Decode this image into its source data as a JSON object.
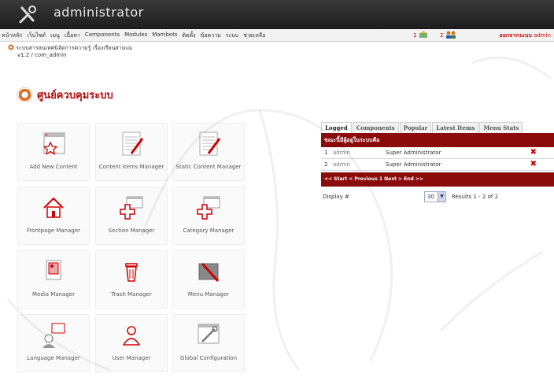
{
  "header": {
    "title": "administrator"
  },
  "menu": {
    "items": [
      "หน้าหลัก",
      "เว็บไซต์",
      "เมนู",
      "เนื้อหา",
      "Components",
      "Modules",
      "Mambots",
      "ติดตั้ง",
      "ข้อความ",
      "ระบบ",
      "ช่วยเหลือ"
    ],
    "messages_count": "1",
    "users_count": "2",
    "logout_prefix": "ออกจากระบบ",
    "logout_user": "admin"
  },
  "sitepath": {
    "site_name": "ระบบสารสนเทศนิจัดการความรู้ เรื่องเรียนสามเณ",
    "version": "v1.2 / com_admin"
  },
  "page": {
    "title": "ศูนย์ควบคุมระบบ"
  },
  "icons": [
    {
      "label": "Add New Content",
      "icon": "add-content-icon"
    },
    {
      "label": "Content Items Manager",
      "icon": "content-items-icon"
    },
    {
      "label": "Static Content Manager",
      "icon": "static-content-icon"
    },
    {
      "label": "Frontpage Manager",
      "icon": "frontpage-icon"
    },
    {
      "label": "Section Manager",
      "icon": "section-icon"
    },
    {
      "label": "Category Manager",
      "icon": "category-icon"
    },
    {
      "label": "Media Manager",
      "icon": "media-icon"
    },
    {
      "label": "Trash Manager",
      "icon": "trash-icon"
    },
    {
      "label": "Menu Manager",
      "icon": "menu-icon"
    },
    {
      "label": "Language Manager",
      "icon": "language-icon"
    },
    {
      "label": "User Manager",
      "icon": "user-icon"
    },
    {
      "label": "Global Configuration",
      "icon": "config-icon"
    }
  ],
  "panel": {
    "tabs": [
      "Logged",
      "Components",
      "Popular",
      "Latest Items",
      "Menu Stats"
    ],
    "active_tab": "Logged",
    "table_header": "ขณะนี้มีผู้อยู่ในระบบคือ",
    "rows": [
      {
        "num": "1",
        "user": "admin",
        "role": "Super Administrator"
      },
      {
        "num": "2",
        "user": "admin",
        "role": "Super Administrator"
      }
    ],
    "pager": "<< Start < Previous 1 Next > End >>",
    "display_label": "Display #",
    "display_value": "30",
    "results": "Results 1 - 2 of 2"
  },
  "colors": {
    "accent": "#8b0a0a",
    "title": "#b30a0a",
    "header_bg": "#262626"
  }
}
